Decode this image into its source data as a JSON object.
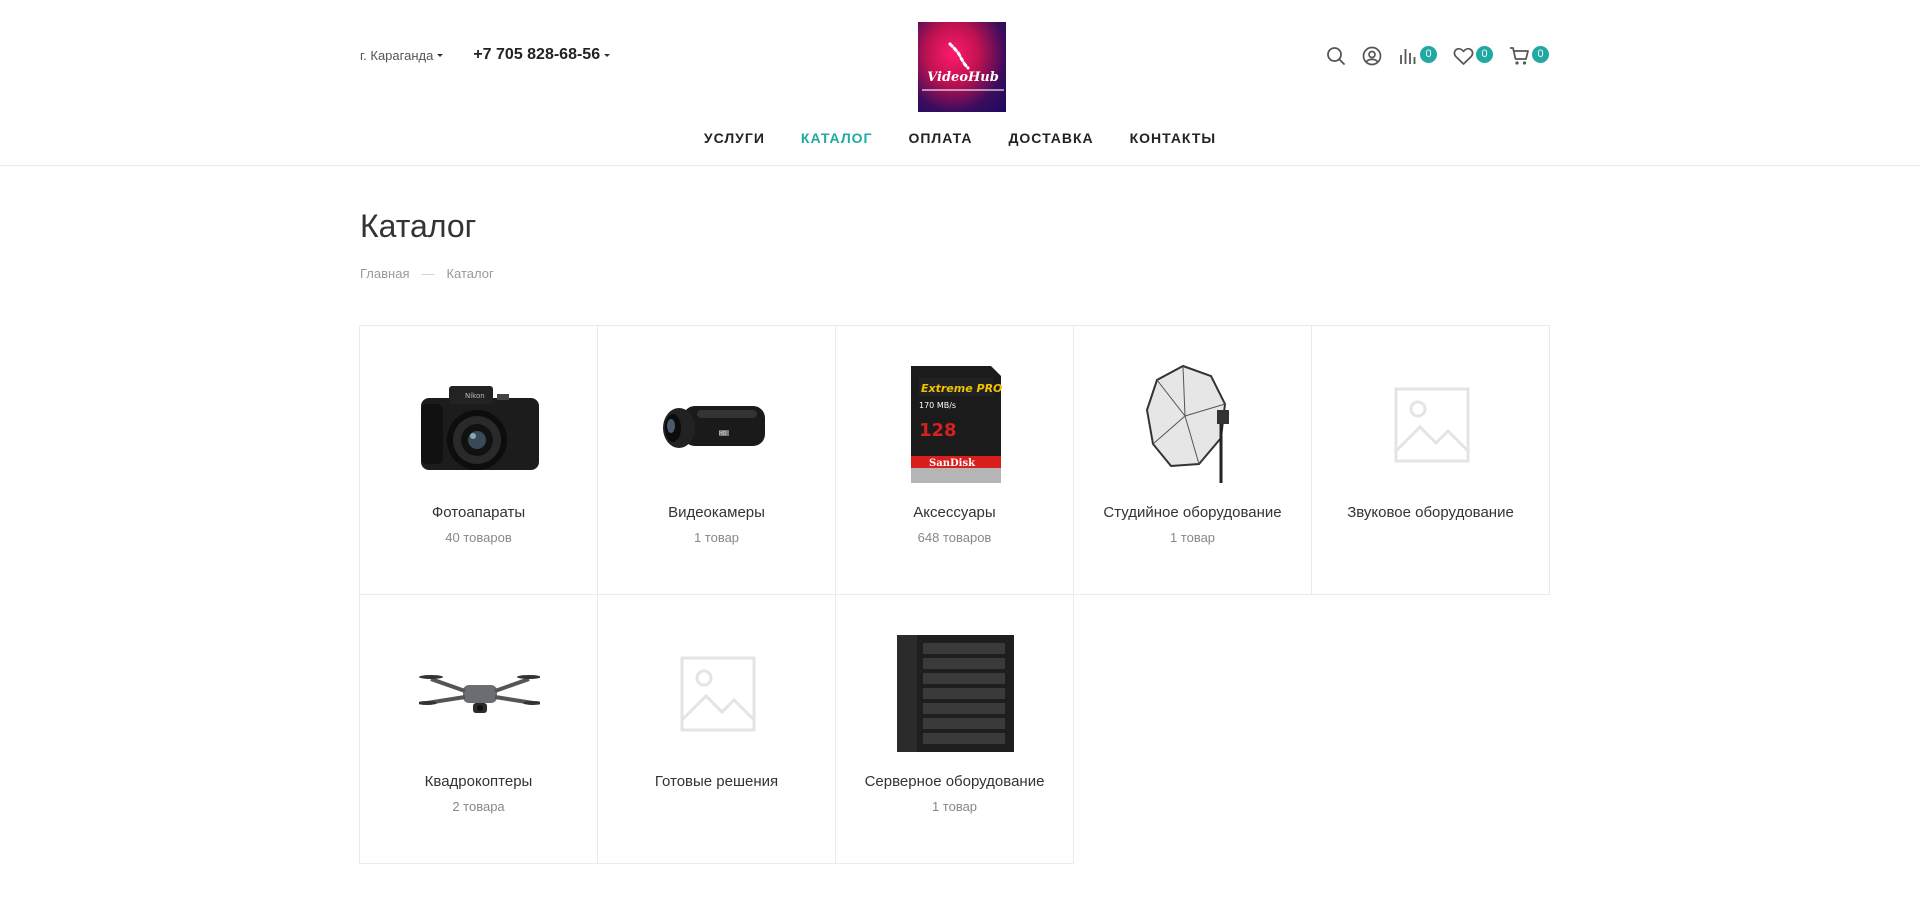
{
  "header": {
    "city": "г. Караганда",
    "phone": "+7 705 828-68-56",
    "logo_text": "VideoHub",
    "compare_count": "0",
    "wishlist_count": "0",
    "cart_count": "0"
  },
  "nav": {
    "items": [
      {
        "label": "УСЛУГИ"
      },
      {
        "label": "КАТАЛОГ"
      },
      {
        "label": "ОПЛАТА"
      },
      {
        "label": "ДОСТАВКА"
      },
      {
        "label": "КОНТАКТЫ"
      }
    ],
    "active": "КАТАЛОГ"
  },
  "page": {
    "title": "Каталог",
    "breadcrumbs": [
      "Главная",
      "Каталог"
    ]
  },
  "categories": [
    {
      "name": "Фотоапараты",
      "count": "40 товаров",
      "icon": "camera-icon"
    },
    {
      "name": "Видеокамеры",
      "count": "1 товар",
      "icon": "camcorder-icon"
    },
    {
      "name": "Аксессуары",
      "count": "648 товаров",
      "icon": "sd-card-icon"
    },
    {
      "name": "Студийное оборудование",
      "count": "1 товар",
      "icon": "softbox-icon"
    },
    {
      "name": "Звуковое оборудование",
      "count": "",
      "icon": "image-placeholder-icon"
    },
    {
      "name": "Квадрокоптеры",
      "count": "2 товара",
      "icon": "drone-icon"
    },
    {
      "name": "Готовые решения",
      "count": "",
      "icon": "image-placeholder-icon"
    },
    {
      "name": "Серверное оборудование",
      "count": "1 товар",
      "icon": "server-icon"
    }
  ],
  "colors": {
    "accent": "#1fa9a1",
    "text": "#333333",
    "muted": "#999999",
    "border": "#ebebeb"
  }
}
